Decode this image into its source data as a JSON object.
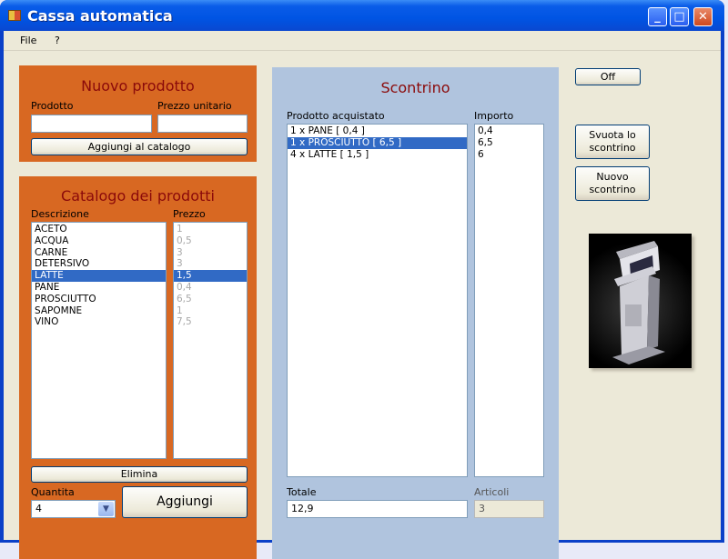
{
  "window": {
    "title": "Cassa automatica",
    "minimize_glyph": "_",
    "maximize_glyph": "□",
    "close_glyph": "✕"
  },
  "menu": [
    "File",
    "?"
  ],
  "nuovo_prodotto": {
    "title": "Nuovo prodotto",
    "prodotto_label": "Prodotto",
    "prezzo_label": "Prezzo unitario",
    "prodotto_value": "",
    "prezzo_value": "",
    "add_button": "Aggiungi al catalogo"
  },
  "catalogo": {
    "title": "Catalogo dei prodotti",
    "col_descrizione": "Descrizione",
    "col_prezzo": "Prezzo",
    "items": [
      {
        "descrizione": "ACETO",
        "prezzo": "1"
      },
      {
        "descrizione": "ACQUA",
        "prezzo": "0,5"
      },
      {
        "descrizione": "CARNE",
        "prezzo": "3"
      },
      {
        "descrizione": "DETERSIVO",
        "prezzo": "3"
      },
      {
        "descrizione": "LATTE",
        "prezzo": "1,5"
      },
      {
        "descrizione": "PANE",
        "prezzo": "0,4"
      },
      {
        "descrizione": "PROSCIUTTO",
        "prezzo": "6,5"
      },
      {
        "descrizione": "SAPOMNE",
        "prezzo": "1"
      },
      {
        "descrizione": "VINO",
        "prezzo": "7,5"
      }
    ],
    "selected_index": 4,
    "elimina_button": "Elimina",
    "quantita_label": "Quantita",
    "quantita_value": "4",
    "aggiungi_button": "Aggiungi"
  },
  "scontrino": {
    "title": "Scontrino",
    "col_prodotto": "Prodotto acquistato",
    "col_importo": "Importo",
    "items": [
      {
        "prodotto": "1 x PANE [ 0,4 ]",
        "importo": "0,4"
      },
      {
        "prodotto": "1 x PROSCIUTTO [ 6,5 ]",
        "importo": "6,5"
      },
      {
        "prodotto": "4 x LATTE [ 1,5 ]",
        "importo": "6"
      }
    ],
    "selected_index": 1,
    "totale_label": "Totale",
    "totale_value": "12,9",
    "articoli_label": "Articoli",
    "articoli_value": "3"
  },
  "side": {
    "off_button": "Off",
    "svuota_line1": "Svuota lo",
    "svuota_line2": "scontrino",
    "nuovo_line1": "Nuovo",
    "nuovo_line2": "scontrino"
  },
  "colors": {
    "panel_orange": "#d86822",
    "panel_title": "#8b0a0a",
    "receipt_blue": "#b0c4de",
    "selection": "#316ac5"
  }
}
